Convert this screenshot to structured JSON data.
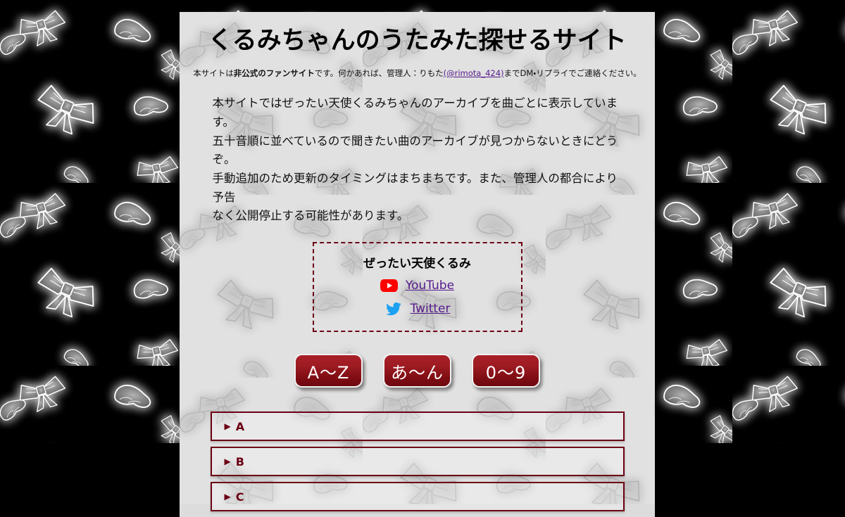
{
  "page": {
    "title": "くるみちゃんのうたみた探せるサイト",
    "background_color": "#000000",
    "panel_color": "#dcdcdc",
    "accent_color": "#6b0014",
    "link_color": "#551a8b"
  },
  "notice": {
    "prefix": "本サイトは",
    "bold": "非公式のファンサイト",
    "middle": "です。何かあれば、管理人：りもた",
    "link": "(@rimota_424)",
    "suffix": "までDM・リプライでご連絡ください。"
  },
  "description": {
    "line1": "本サイトではぜったい天使くるみちゃんのアーカイブを曲ごとに表示しています。",
    "line2": "五十音順に並べているので聞きたい曲のアーカイブが見つからないときにどうぞ。",
    "line3": "手動追加のため更新のタイミングはまちまちです。また、管理人の都合により予告",
    "line4": "なく公開停止する可能性があります。"
  },
  "links_box": {
    "title": "ぜったい天使くるみ",
    "items": [
      {
        "icon": "youtube-icon",
        "label": "YouTube",
        "color": "#ff0000"
      },
      {
        "icon": "twitter-icon",
        "label": "Twitter",
        "color": "#1da1f2"
      }
    ]
  },
  "index_buttons": [
    {
      "label": "A〜Z",
      "name": "index-button-az"
    },
    {
      "label": "あ〜ん",
      "name": "index-button-aiueo"
    },
    {
      "label": "0〜9",
      "name": "index-button-digits"
    }
  ],
  "accordion": {
    "marker": "▶",
    "items": [
      {
        "label": "A"
      },
      {
        "label": "B"
      },
      {
        "label": "C"
      }
    ]
  }
}
